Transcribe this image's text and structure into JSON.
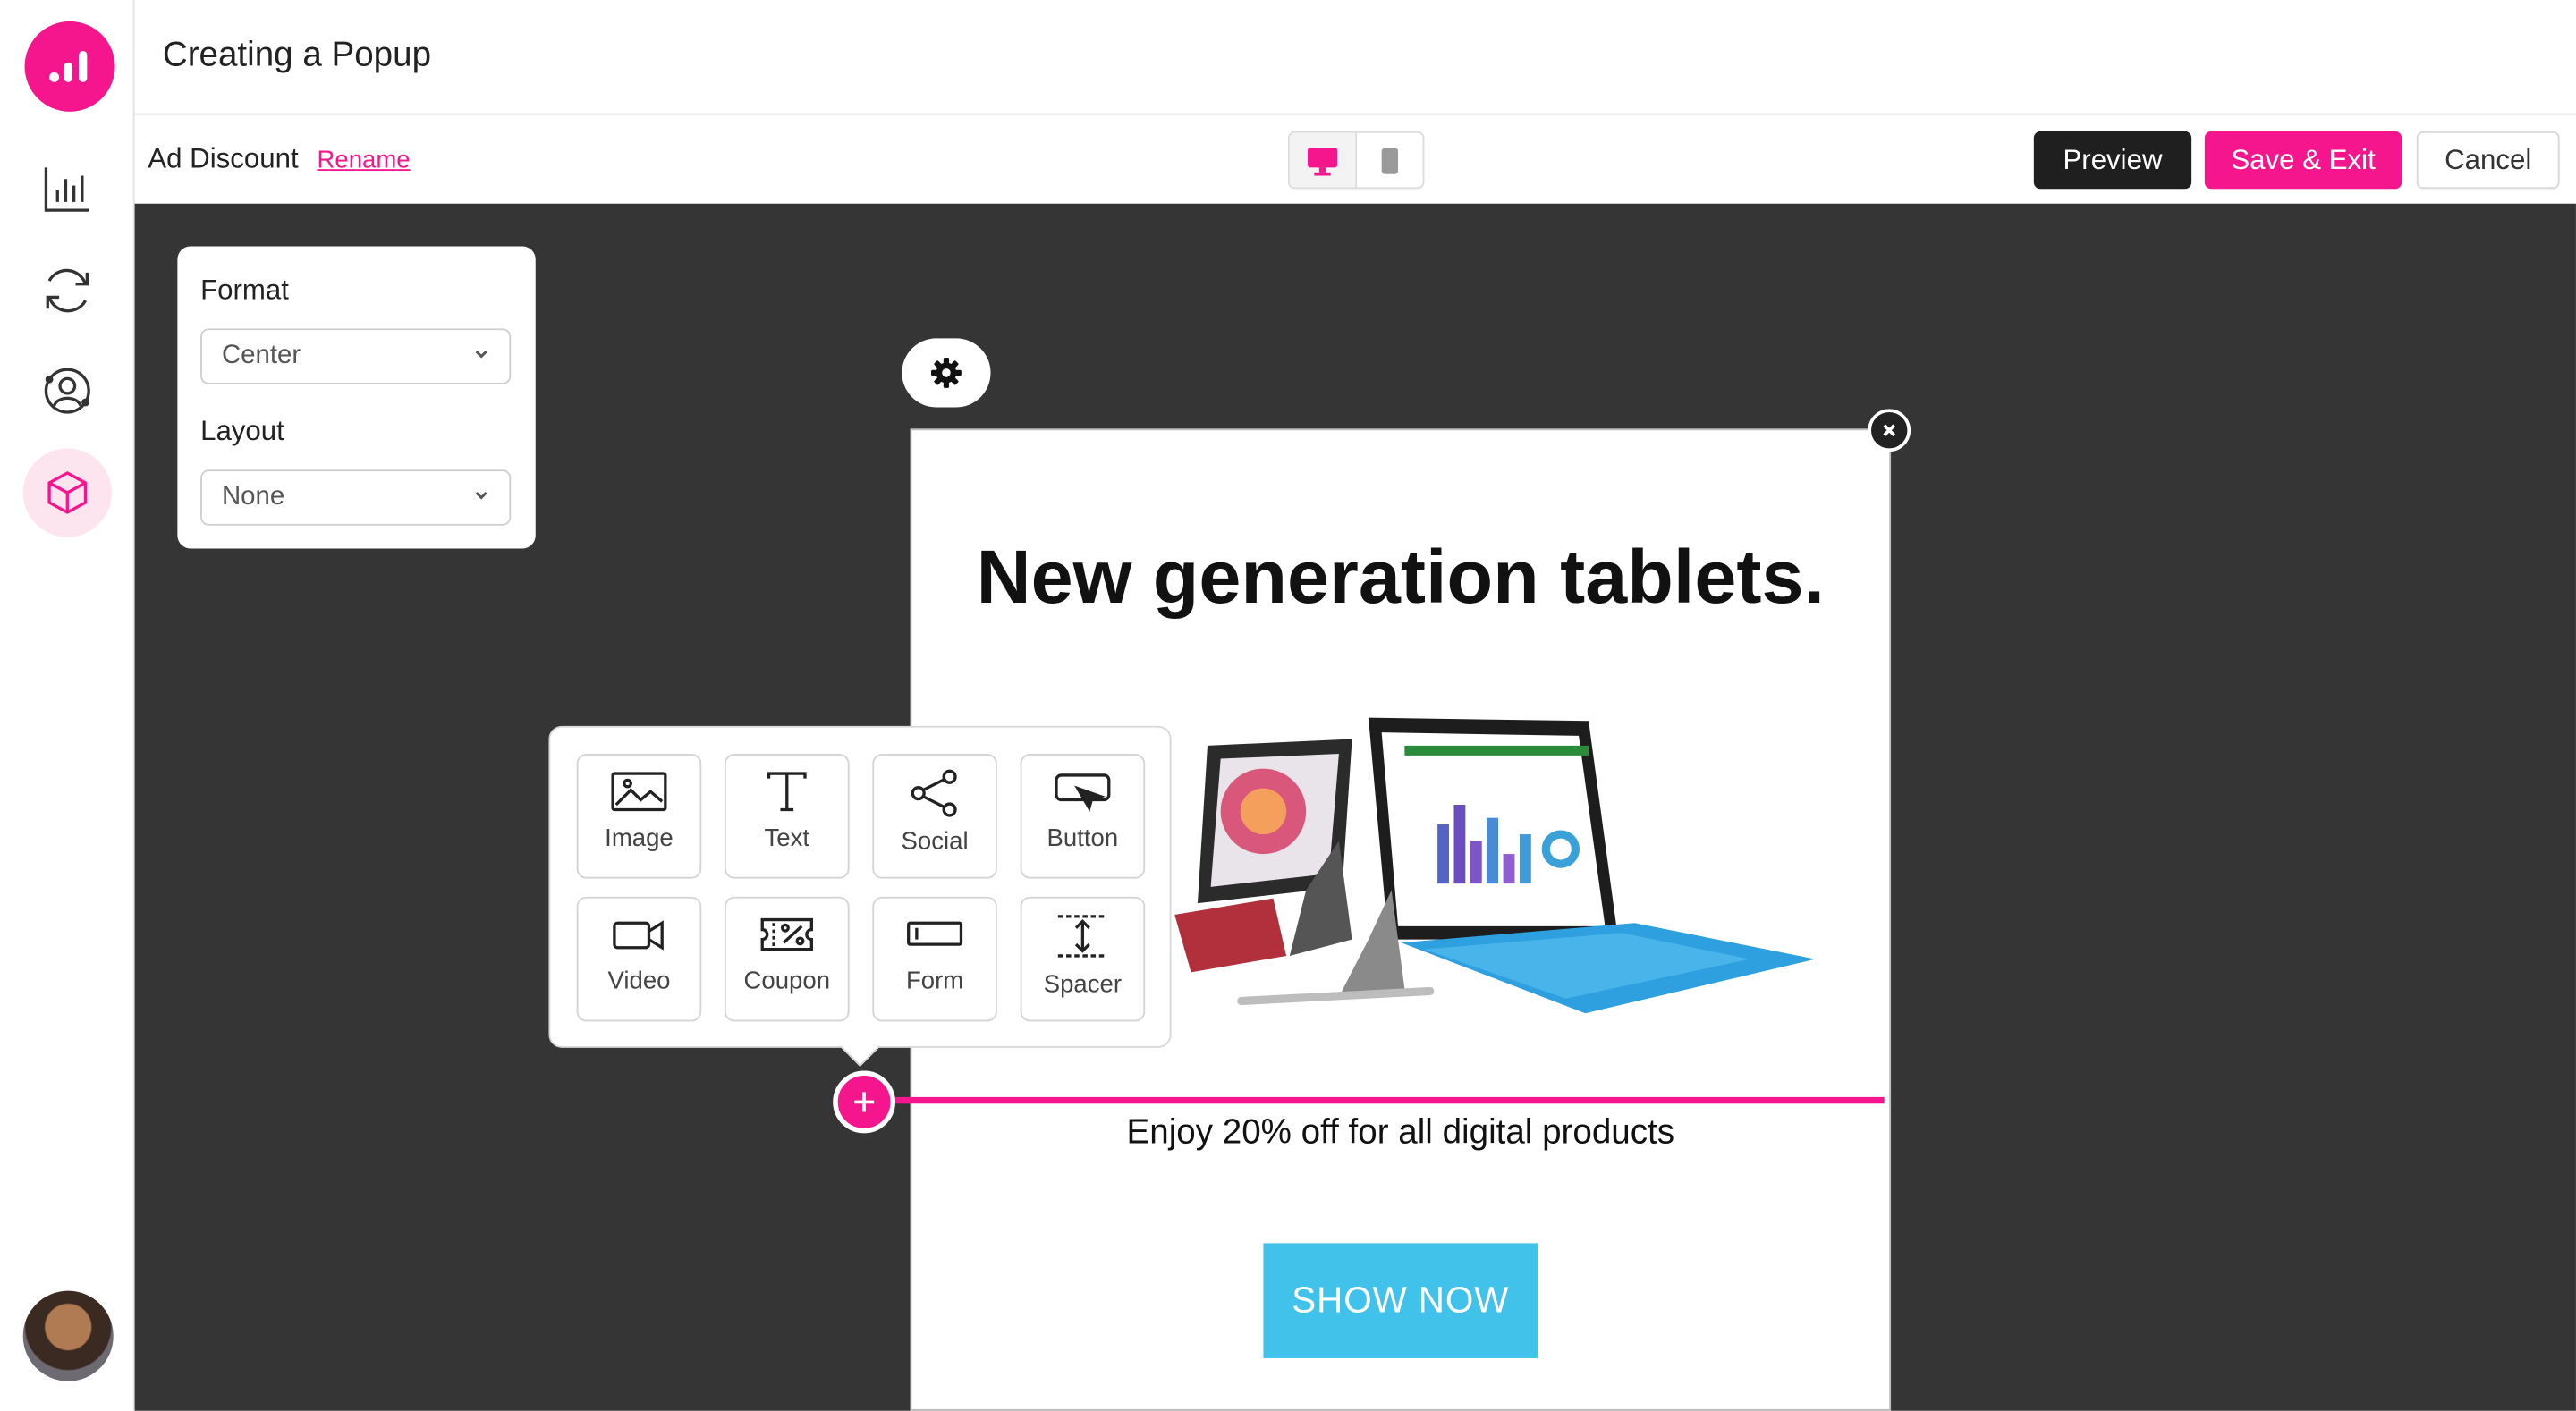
{
  "app": {
    "title": "Creating a Popup"
  },
  "toolbar": {
    "ad_name": "Ad Discount",
    "rename_label": "Rename",
    "preview_label": "Preview",
    "save_label": "Save & Exit",
    "cancel_label": "Cancel"
  },
  "format_panel": {
    "format_label": "Format",
    "format_value": "Center",
    "layout_label": "Layout",
    "layout_value": "None"
  },
  "popup": {
    "heading": "New generation tablets.",
    "subtext": "Enjoy 20% off for all digital products",
    "cta_label": "SHOW NOW"
  },
  "palette": {
    "items": [
      {
        "label": "Image",
        "icon": "image-icon"
      },
      {
        "label": "Text",
        "icon": "text-icon"
      },
      {
        "label": "Social",
        "icon": "share-icon"
      },
      {
        "label": "Button",
        "icon": "button-icon"
      },
      {
        "label": "Video",
        "icon": "video-icon"
      },
      {
        "label": "Coupon",
        "icon": "coupon-icon"
      },
      {
        "label": "Form",
        "icon": "form-icon"
      },
      {
        "label": "Spacer",
        "icon": "spacer-icon"
      }
    ]
  },
  "colors": {
    "accent": "#f5158c",
    "canvas": "#353535",
    "cta": "#40c2ea",
    "dark": "#1f1f1f"
  }
}
